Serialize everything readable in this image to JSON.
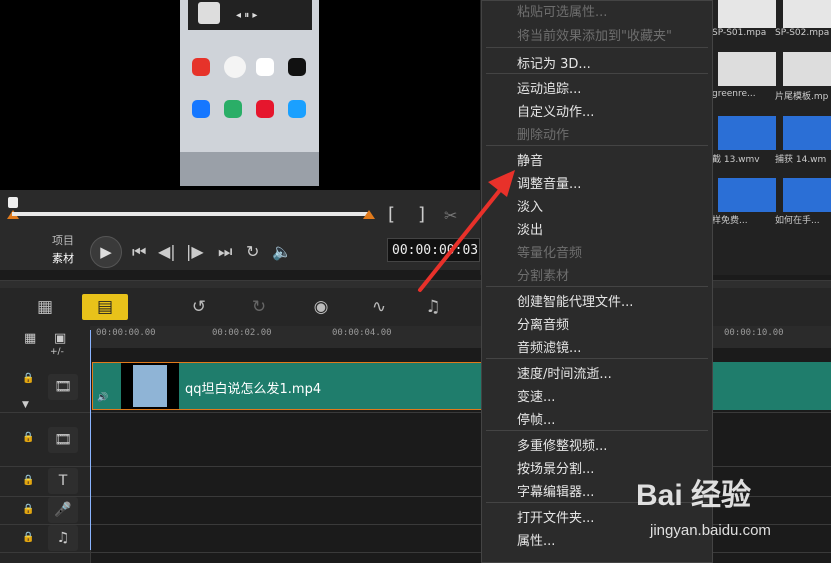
{
  "player": {
    "mode_project": "项目",
    "mode_clip": "素材",
    "timecode": "00:00:00:03",
    "trim_in_label": "[",
    "trim_out_label": "]"
  },
  "library": {
    "items": [
      {
        "label": "SP-S01.mpa"
      },
      {
        "label": "SP-S02.mpa"
      },
      {
        "label": "greenre..."
      },
      {
        "label": "片尾模板.mp"
      },
      {
        "label": "截 13.wmv"
      },
      {
        "label": "捕获 14.wm"
      },
      {
        "label": "样免费..."
      },
      {
        "label": "如何在手..."
      }
    ]
  },
  "timeline": {
    "ruler_ticks": [
      "00:00:00.00",
      "00:00:02.00",
      "00:00:04.00",
      "00:00:10.00"
    ],
    "add_track_label": "+/-",
    "clip_name": "qq坦白说怎么发1.mp4",
    "colors": {
      "clip": "#1f7d6c",
      "clip_border": "#e07a1c",
      "playhead": "#8ab4ff"
    }
  },
  "context_menu": {
    "items": [
      {
        "label": "粘贴可选属性...",
        "enabled": false
      },
      {
        "label": "将当前效果添加到\"收藏夹\"",
        "enabled": false
      },
      {
        "label": "标记为 3D...",
        "enabled": true
      },
      {
        "label": "运动追踪...",
        "enabled": true
      },
      {
        "label": "自定义动作...",
        "enabled": true
      },
      {
        "label": "删除动作",
        "enabled": false
      },
      {
        "label": "静音",
        "enabled": true
      },
      {
        "label": "调整音量...",
        "enabled": true
      },
      {
        "label": "淡入",
        "enabled": true
      },
      {
        "label": "淡出",
        "enabled": true
      },
      {
        "label": "等量化音频",
        "enabled": false
      },
      {
        "label": "分割素材",
        "enabled": false
      },
      {
        "label": "创建智能代理文件...",
        "enabled": true
      },
      {
        "label": "分离音频",
        "enabled": true
      },
      {
        "label": "音频滤镜...",
        "enabled": true
      },
      {
        "label": "速度/时间流逝...",
        "enabled": true
      },
      {
        "label": "变速...",
        "enabled": true
      },
      {
        "label": "停帧...",
        "enabled": true
      },
      {
        "label": "多重修整视频...",
        "enabled": true
      },
      {
        "label": "按场景分割...",
        "enabled": true
      },
      {
        "label": "字幕编辑器...",
        "enabled": true
      },
      {
        "label": "打开文件夹...",
        "enabled": true
      },
      {
        "label": "属性...",
        "enabled": true
      }
    ]
  },
  "watermark": {
    "logo": "Bai 经验",
    "url": "jingyan.baidu.com"
  },
  "annotation": {
    "arrow_color": "#e8312a"
  }
}
